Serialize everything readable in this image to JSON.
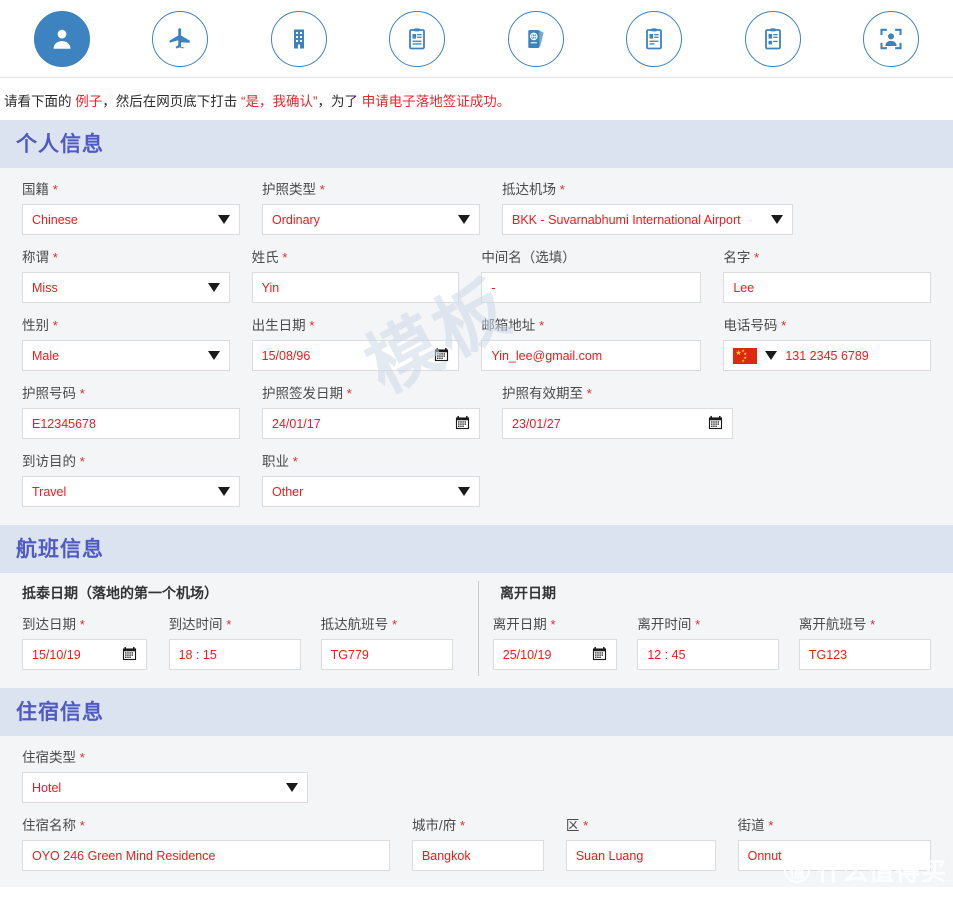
{
  "steps": [
    {
      "id": "personal-info",
      "icon": "person-icon",
      "active": true
    },
    {
      "id": "flight",
      "icon": "airplane-icon",
      "active": false
    },
    {
      "id": "accommodation",
      "icon": "building-icon",
      "active": false
    },
    {
      "id": "document-1",
      "icon": "clipboard-icon",
      "active": false
    },
    {
      "id": "passport",
      "icon": "passport-icon",
      "active": false
    },
    {
      "id": "document-2",
      "icon": "clipboard-icon",
      "active": false
    },
    {
      "id": "document-3",
      "icon": "clipboard-icon",
      "active": false
    },
    {
      "id": "photo",
      "icon": "photo-id-icon",
      "active": false
    }
  ],
  "instruction": {
    "part1": "请看下面的 ",
    "highlight1": "例子",
    "part2": "，然后在网页底下打击 ",
    "highlight2": "“是，我确认”",
    "part3": "，为了 ",
    "highlight3": "申请电子落地签证成功。"
  },
  "personal": {
    "title": "个人信息",
    "nationality": {
      "label": "国籍",
      "required": "*",
      "value": "Chinese"
    },
    "passport_type": {
      "label": "护照类型",
      "required": "*",
      "value": "Ordinary"
    },
    "arrival_airport": {
      "label": "抵达机场",
      "required": "*",
      "value": "BKK - Suvarnabhumi International Airport"
    },
    "title_of": {
      "label": "称谓",
      "required": "*",
      "value": "Miss"
    },
    "surname": {
      "label": "姓氏",
      "required": "*",
      "value": "Yin"
    },
    "middle_name": {
      "label": "中间名（选填）",
      "required": "",
      "value": "-"
    },
    "given_name": {
      "label": "名字",
      "required": "*",
      "value": "Lee"
    },
    "gender": {
      "label": "性别",
      "required": "*",
      "value": "Male"
    },
    "birth_date": {
      "label": "出生日期",
      "required": "*",
      "value": "15/08/96"
    },
    "email": {
      "label": "邮箱地址",
      "required": "*",
      "value": "Yin_lee@gmail.com"
    },
    "phone": {
      "label": "电话号码",
      "required": "*",
      "value": "131 2345 6789",
      "country_flag": "china-flag"
    },
    "passport_no": {
      "label": "护照号码",
      "required": "*",
      "value": "E12345678"
    },
    "passport_issue": {
      "label": "护照签发日期",
      "required": "*",
      "value": "24/01/17"
    },
    "passport_expiry": {
      "label": "护照有效期至",
      "required": "*",
      "value": "23/01/27"
    },
    "purpose": {
      "label": "到访目的",
      "required": "*",
      "value": "Travel"
    },
    "occupation": {
      "label": "职业",
      "required": "*",
      "value": "Other"
    }
  },
  "flight": {
    "title": "航班信息",
    "arrival_group_title": "抵泰日期（落地的第一个机场）",
    "departure_group_title": "离开日期",
    "arrival_date": {
      "label": "到达日期",
      "required": "*",
      "value": "15/10/19"
    },
    "arrival_time": {
      "label": "到达时间",
      "required": "*",
      "value": "18 : 15"
    },
    "arrival_flight_no": {
      "label": "抵达航班号",
      "required": "*",
      "value": "TG779"
    },
    "departure_date": {
      "label": "离开日期",
      "required": "*",
      "value": "25/10/19"
    },
    "departure_time": {
      "label": "离开时间",
      "required": "*",
      "value": "12 : 45"
    },
    "departure_flight_no": {
      "label": "离开航班号",
      "required": "*",
      "value": "TG123"
    }
  },
  "accommodation": {
    "title": "住宿信息",
    "type": {
      "label": "住宿类型",
      "required": "*",
      "value": "Hotel"
    },
    "name": {
      "label": "住宿名称",
      "required": "*",
      "value": "OYO 246 Green Mind Residence"
    },
    "city": {
      "label": "城市/府",
      "required": "*",
      "value": "Bangkok"
    },
    "district": {
      "label": "区",
      "required": "*",
      "value": "Suan Luang"
    },
    "street": {
      "label": "街道",
      "required": "*",
      "value": "Onnut"
    }
  },
  "watermarks": {
    "template": "模板",
    "site_badge": "值",
    "site_text": "什么值得买"
  },
  "colors": {
    "accent_blue": "#3d83bf",
    "section_header_text": "#4f5bc4",
    "section_header_bg": "#dce3f0",
    "value_red": "#f21b1b",
    "required_red": "#e8262b",
    "body_bg": "#f4f5f7"
  }
}
